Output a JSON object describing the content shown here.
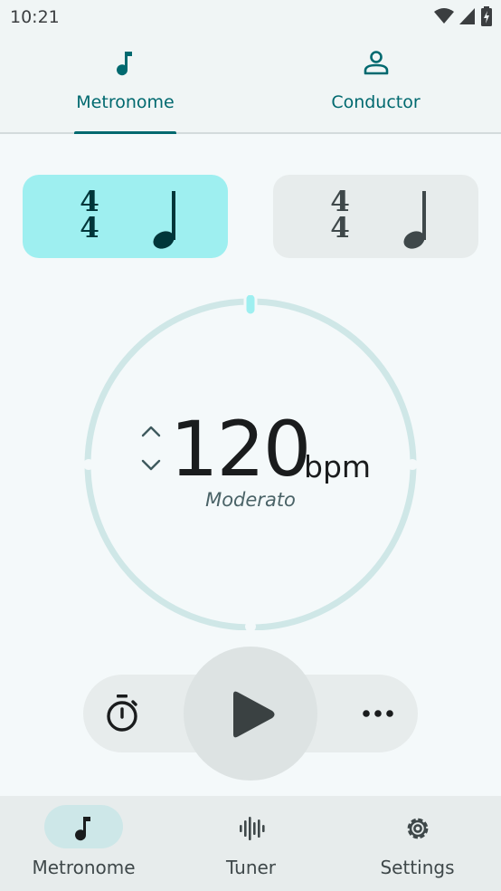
{
  "status_bar": {
    "time": "10:21",
    "icons": [
      "wifi-icon",
      "signal-icon",
      "battery-charging-icon"
    ]
  },
  "top_tabs": [
    {
      "label": "Metronome",
      "icon": "music-note-icon",
      "selected": true
    },
    {
      "label": "Conductor",
      "icon": "person-icon",
      "selected": false
    }
  ],
  "time_signatures": [
    {
      "numerator": "4",
      "denominator": "4",
      "beat_unit": "quarter-note-icon",
      "active": true
    },
    {
      "numerator": "4",
      "denominator": "4",
      "beat_unit": "quarter-note-icon",
      "active": false
    }
  ],
  "tempo": {
    "value": "120",
    "unit": "bpm",
    "name": "Moderato"
  },
  "controls": {
    "timer_icon": "stopwatch-icon",
    "play_icon": "play-icon",
    "more_icon": "more-horizontal-icon"
  },
  "bottom_nav": [
    {
      "label": "Metronome",
      "icon": "music-note-icon",
      "selected": true
    },
    {
      "label": "Tuner",
      "icon": "waveform-icon",
      "selected": false
    },
    {
      "label": "Settings",
      "icon": "gear-icon",
      "selected": false
    }
  ],
  "colors": {
    "accent": "#00696f",
    "active_card": "#9eeff0",
    "dial_ring": "#cfe7e7",
    "background": "#f4f9fa"
  }
}
